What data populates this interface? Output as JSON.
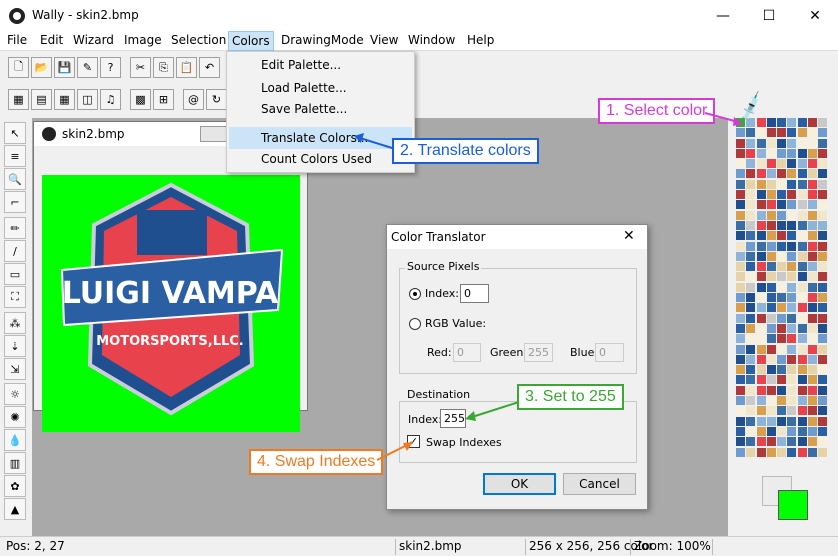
{
  "window": {
    "title": "Wally - skin2.bmp",
    "minimize": "—",
    "maximize": "☐",
    "close": "✕"
  },
  "menu": [
    "File",
    "Edit",
    "Wizard",
    "Image",
    "Selection",
    "Colors",
    "DrawingMode",
    "View",
    "Window",
    "Help"
  ],
  "colors_menu": [
    "Edit Palette...",
    "Load Palette...",
    "Save Palette...",
    "Translate Colors...",
    "Count Colors Used"
  ],
  "child": {
    "title": "skin2.bmp",
    "logo_line1": "LUIGI VAMPA",
    "logo_line2": "MOTORSPORTS,LLC."
  },
  "dialog": {
    "title": "Color Translator",
    "source_group": "Source Pixels",
    "index_label": "Index:",
    "index_value": "0",
    "rgb_label": "RGB Value:",
    "red_label": "Red:",
    "red_value": "0",
    "green_label": "Green:",
    "green_value": "255",
    "blue_label": "Blue:",
    "blue_value": "0",
    "dest_group": "Destination",
    "dest_index_label": "Index:",
    "dest_index_value": "255",
    "swap_label": "Swap Indexes",
    "ok": "OK",
    "cancel": "Cancel"
  },
  "callouts": {
    "c1": "1. Select color",
    "c2": "2. Translate colors",
    "c3": "3. Set to 255",
    "c4": "4. Swap Indexes"
  },
  "status": {
    "pos": "Pos:  2, 27",
    "file": "skin2.bmp",
    "info": "256 x 256, 256 color",
    "zoom": "Zoom: 100%"
  },
  "accent": {
    "highlight": "#cce4f7",
    "green": "#00ff00",
    "callout1": "#d63bd6",
    "callout2": "#1a5fd8",
    "callout3": "#3aa832",
    "callout4": "#f07a20"
  }
}
